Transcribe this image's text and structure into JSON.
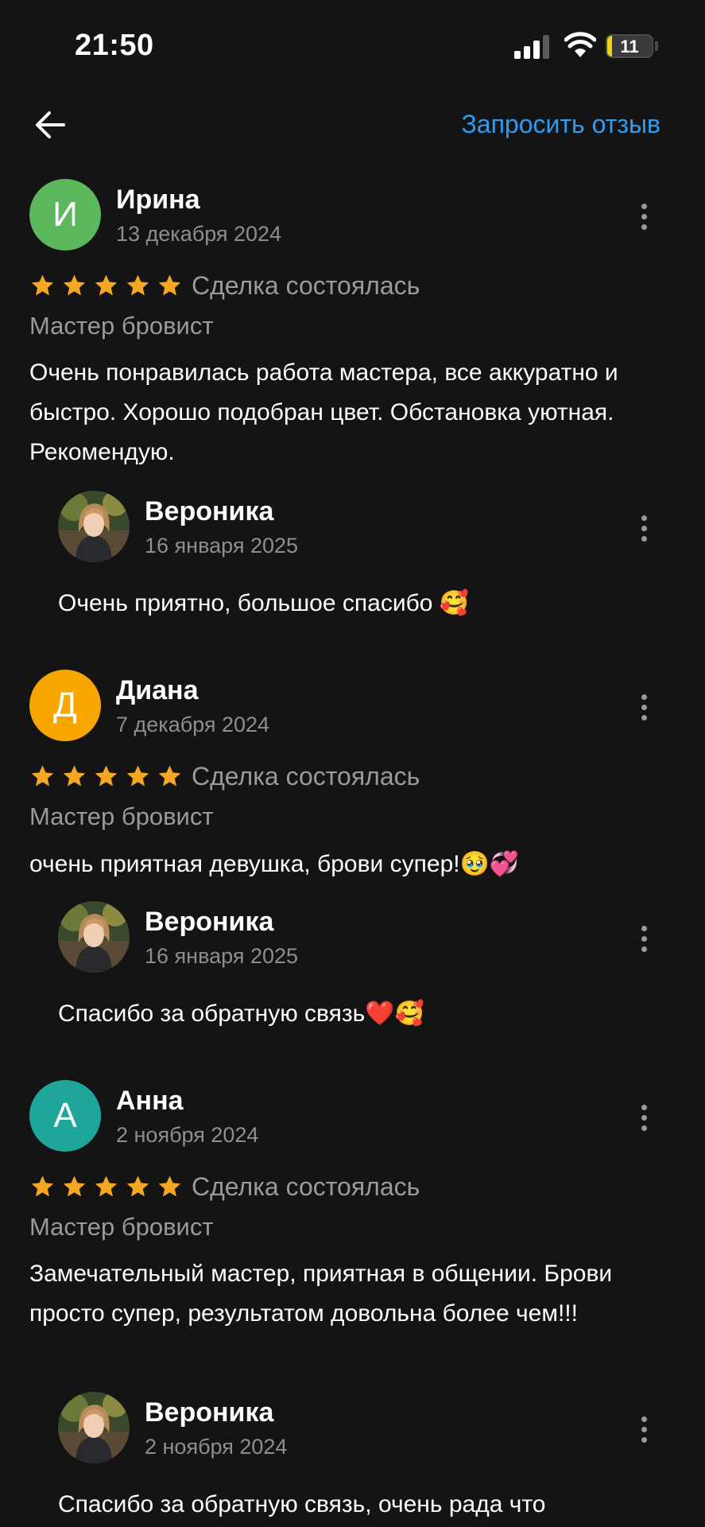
{
  "status_bar": {
    "time": "21:50",
    "battery": "11",
    "battery_level": 0.11
  },
  "header": {
    "request_review_label": "Запросить отзыв"
  },
  "colors": {
    "accent": "#2f9cf0",
    "star": "#f5a623",
    "background": "#141414"
  },
  "reviews": [
    {
      "initial": "И",
      "avatar_color": "#5cb85c",
      "author": "Ирина",
      "date": "13 декабря 2024",
      "rating": 5,
      "status": "Сделка состоялась",
      "category": "Мастер бровист",
      "text": "Очень понравилась работа мастера, все аккуратно и быстро. Хорошо подобран цвет. Обстановка уютная. Рекомендую.",
      "reply": {
        "author": "Вероника",
        "date": "16 января 2025",
        "text": "Очень приятно, большое спасибо 🥰"
      }
    },
    {
      "initial": "Д",
      "avatar_color": "#f7a600",
      "author": "Диана",
      "date": "7 декабря 2024",
      "rating": 5,
      "status": "Сделка состоялась",
      "category": "Мастер бровист",
      "text": "очень приятная девушка, брови супер!🥹💞",
      "reply": {
        "author": "Вероника",
        "date": "16 января 2025",
        "text": "Спасибо за обратную связь❤️🥰"
      }
    },
    {
      "initial": "А",
      "avatar_color": "#1fa69a",
      "author": "Анна",
      "date": "2 ноября 2024",
      "rating": 5,
      "status": "Сделка состоялась",
      "category": "Мастер бровист",
      "text": "Замечательный мастер, приятная в общении. Брови просто супер, результатом довольна более чем!!!",
      "reply": {
        "author": "Вероника",
        "date": "2 ноября 2024",
        "text": "Спасибо за обратную связь, очень рада что"
      }
    }
  ]
}
